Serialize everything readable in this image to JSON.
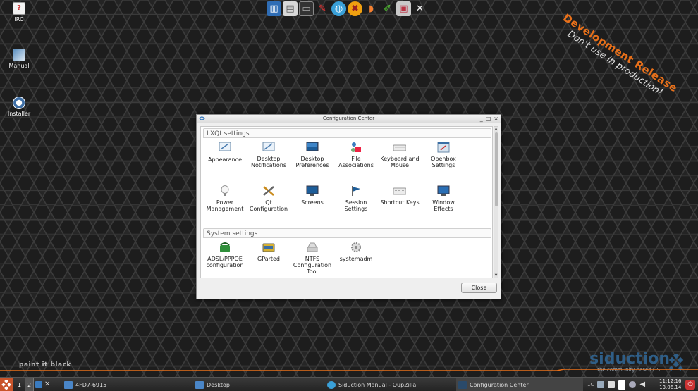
{
  "desktop": {
    "icons": [
      {
        "label": "IRC"
      },
      {
        "label": "Manual"
      },
      {
        "label": "Installer"
      }
    ],
    "quick_launch": [
      "system-monitor-icon",
      "file-manager-icon",
      "terminal-icon",
      "text-editor-icon",
      "browser-icon",
      "media-player-icon",
      "image-viewer-icon",
      "paint-icon",
      "screenshot-icon",
      "settings-tools-icon"
    ],
    "dev_release_line1": "Development Release",
    "dev_release_line2": "Don't use in production!",
    "slogan": "paint it black",
    "brand_name": "siduction",
    "brand_tagline": "the community based OS",
    "accent_color": "#e8701a"
  },
  "dialog": {
    "title": "Configuration Center",
    "window_buttons": {
      "minimize": "_",
      "maximize": "□",
      "close": "×"
    },
    "sections": [
      {
        "header": "LXQt settings",
        "items": [
          {
            "label": "Appearance",
            "icon": "appearance-icon",
            "selected": true
          },
          {
            "label": "Desktop Notifications",
            "icon": "notifications-icon"
          },
          {
            "label": "Desktop Preferences",
            "icon": "desktop-prefs-icon"
          },
          {
            "label": "File Associations",
            "icon": "file-assoc-icon"
          },
          {
            "label": "Keyboard and Mouse",
            "icon": "keyboard-icon"
          },
          {
            "label": "Openbox Settings",
            "icon": "openbox-icon"
          },
          {
            "label": "Power Management",
            "icon": "power-icon"
          },
          {
            "label": "Qt Configuration",
            "icon": "qt-config-icon"
          },
          {
            "label": "Screens",
            "icon": "screens-icon"
          },
          {
            "label": "Session Settings",
            "icon": "session-icon"
          },
          {
            "label": "Shortcut Keys",
            "icon": "shortcut-keys-icon"
          },
          {
            "label": "Window Effects",
            "icon": "window-effects-icon"
          }
        ]
      },
      {
        "header": "System settings",
        "items": [
          {
            "label": "ADSL/PPPOE configuration",
            "icon": "adsl-icon"
          },
          {
            "label": "GParted",
            "icon": "gparted-icon"
          },
          {
            "label": "NTFS Configuration Tool",
            "icon": "ntfs-icon"
          },
          {
            "label": "systemadm",
            "icon": "systemadm-icon"
          }
        ]
      }
    ],
    "close_label": "Close"
  },
  "taskbar": {
    "desktops": [
      "1",
      "2"
    ],
    "tasks": [
      {
        "label": "4FD7-6915"
      },
      {
        "label": "Desktop"
      },
      {
        "label": "Siduction Manual - QupZilla"
      },
      {
        "label": "Configuration Center"
      }
    ],
    "tray_label": "1C",
    "time": "11:12:16",
    "date": "13.06.14"
  }
}
